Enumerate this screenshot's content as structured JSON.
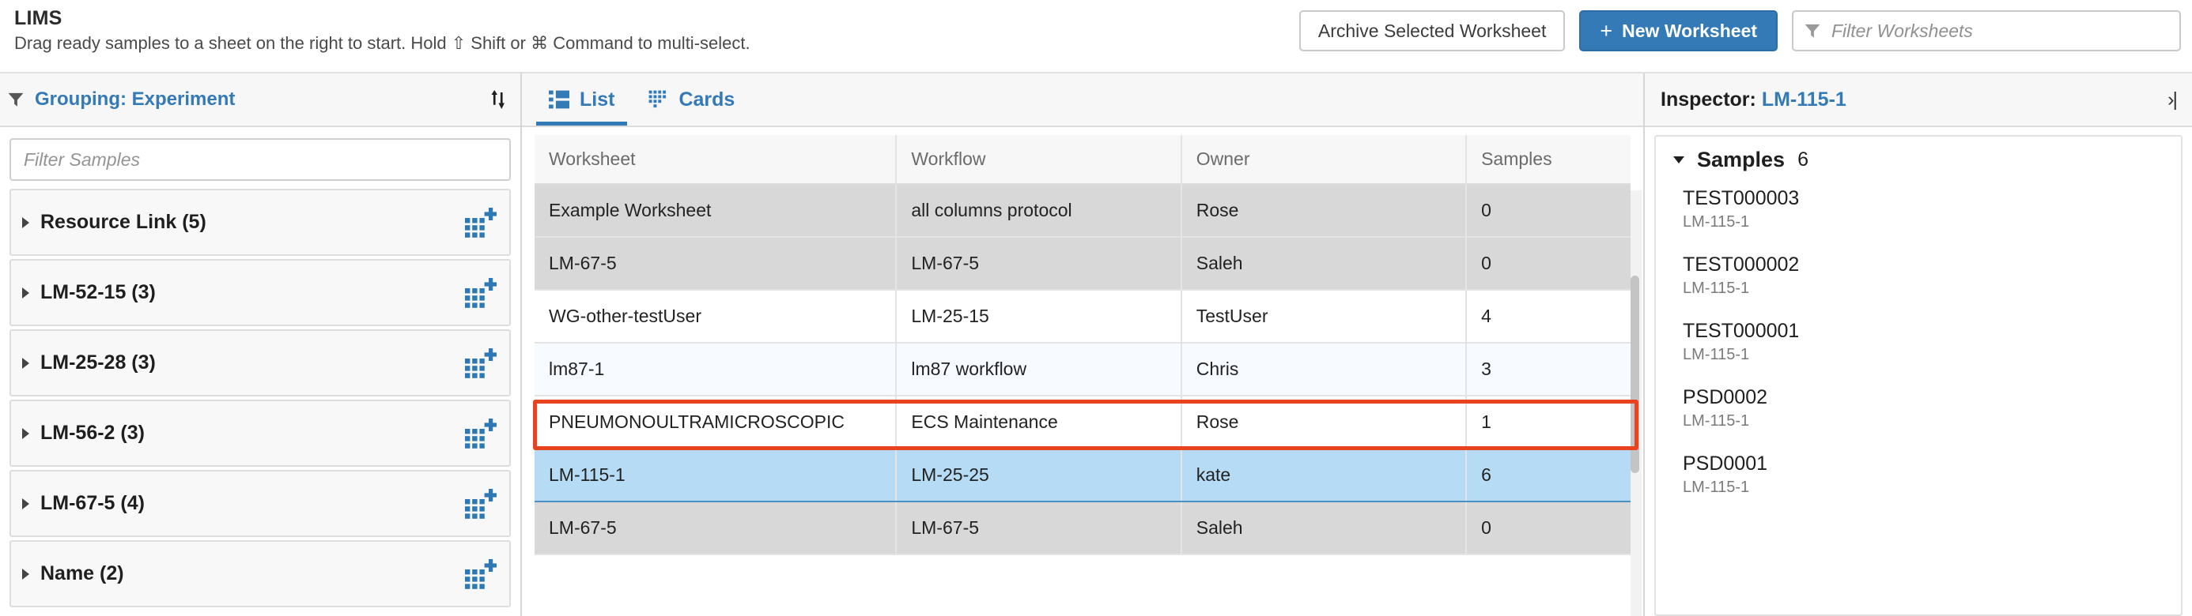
{
  "header": {
    "app_title": "LIMS",
    "subtitle": "Drag ready samples to a sheet on the right to start. Hold ⇧ Shift or ⌘ Command to multi-select.",
    "archive_button": "Archive Selected Worksheet",
    "new_worksheet_button": "New Worksheet",
    "new_worksheet_plus": "+",
    "filter_placeholder": "Filter Worksheets"
  },
  "sidebar": {
    "grouping_label": "Grouping: Experiment",
    "filter_placeholder": "Filter Samples",
    "groups": [
      {
        "label": "Resource Link (5)"
      },
      {
        "label": "LM-52-15 (3)"
      },
      {
        "label": "LM-25-28 (3)"
      },
      {
        "label": "LM-56-2 (3)"
      },
      {
        "label": "LM-67-5 (4)"
      },
      {
        "label": "Name (2)"
      }
    ]
  },
  "center": {
    "tabs": [
      {
        "label": "List",
        "active": true
      },
      {
        "label": "Cards",
        "active": false
      }
    ],
    "columns": [
      "Worksheet",
      "Workflow",
      "Owner",
      "Samples"
    ],
    "rows": [
      {
        "worksheet": "Example Worksheet",
        "workflow": "all columns protocol",
        "owner": "Rose",
        "samples": "0",
        "style": "row-gray"
      },
      {
        "worksheet": "LM-67-5",
        "workflow": "LM-67-5",
        "owner": "Saleh",
        "samples": "0",
        "style": "row-gray"
      },
      {
        "worksheet": "WG-other-testUser",
        "workflow": "LM-25-15",
        "owner": "TestUser",
        "samples": "4",
        "style": "row-white"
      },
      {
        "worksheet": "lm87-1",
        "workflow": "lm87 workflow",
        "owner": "Chris",
        "samples": "3",
        "style": "row-pale"
      },
      {
        "worksheet": "PNEUMONOULTRAMICROSCOPIC",
        "workflow": "ECS Maintenance",
        "owner": "Rose",
        "samples": "1",
        "style": "row-white"
      },
      {
        "worksheet": "LM-115-1",
        "workflow": "LM-25-25",
        "owner": "kate",
        "samples": "6",
        "style": "row-sel"
      },
      {
        "worksheet": "LM-67-5",
        "workflow": "LM-67-5",
        "owner": "Saleh",
        "samples": "0",
        "style": "row-gray"
      }
    ]
  },
  "inspector": {
    "title_prefix": "Inspector:",
    "worksheet_name": "LM-115-1",
    "collapse_icon": "›|",
    "samples_title": "Samples",
    "samples_count": "6",
    "samples": [
      {
        "name": "TEST000003",
        "sub": "LM-115-1"
      },
      {
        "name": "TEST000002",
        "sub": "LM-115-1"
      },
      {
        "name": "TEST000001",
        "sub": "LM-115-1"
      },
      {
        "name": "PSD0002",
        "sub": "LM-115-1"
      },
      {
        "name": "PSD0001",
        "sub": "LM-115-1"
      }
    ]
  },
  "annotations": {
    "highlight_color": "#e8421f",
    "arrow_color": "#e8421f"
  }
}
